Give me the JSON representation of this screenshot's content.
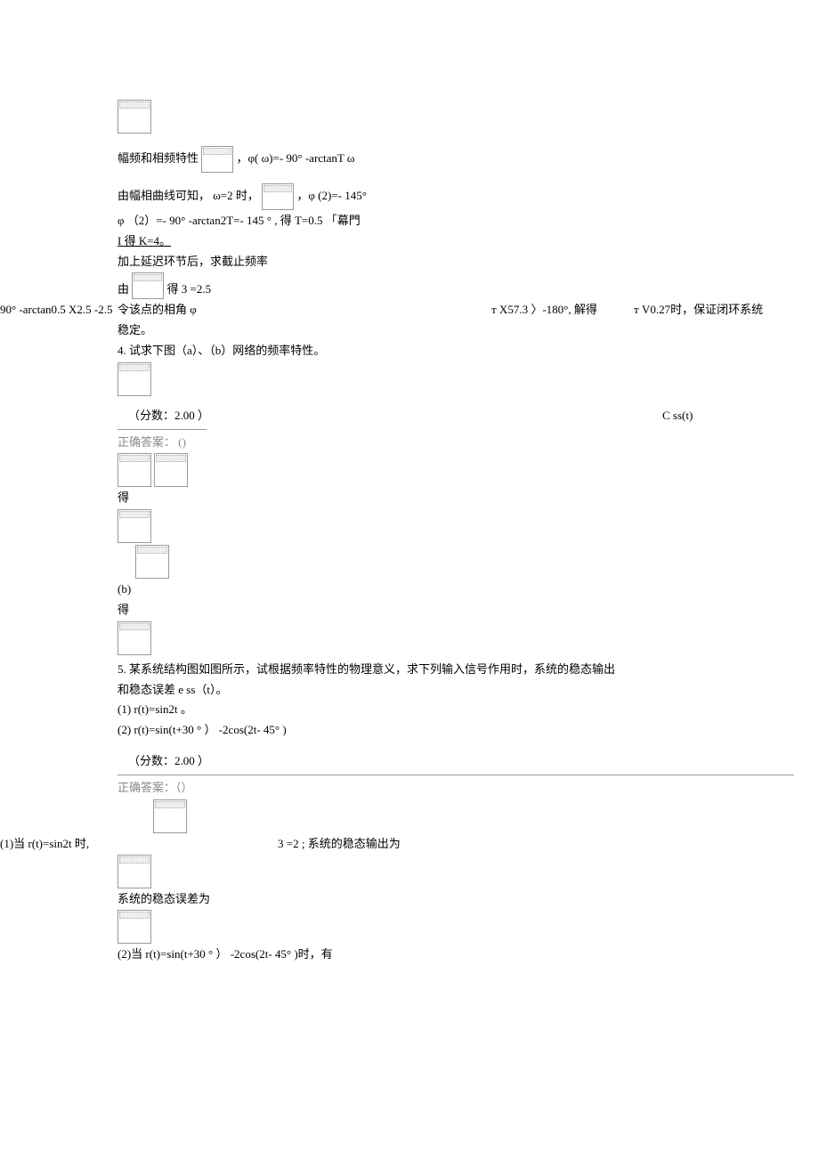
{
  "sec1": {
    "l1a": "幅频和相频特性",
    "l1b": "，φ( ω)=- 90°  -arctanT    ω",
    "l2a": "由幅相曲线可知，    ω=2 时，",
    "l2b": "，φ (2)=-  145°",
    "l3": "φ （2）=- 90°   -arctan2T=- 145 ° , 得  T=0.5 「幕門",
    "l4": "I         得 K=4。",
    "l5": "加上延迟环节后，求截止频率",
    "l6a": "由",
    "l6b": "得  3 =2.5"
  },
  "wide1": {
    "left": "90° -arctan0.5 X2.5 -2.5 ",
    "mid": "令该点的相角 φ",
    "t1": "т X57.3 〉-180°, 解得",
    "t2": "т V0.27时，保证闭环系统"
  },
  "sec2": {
    "l0": "稳定。",
    "q4": "4.      试求下图（a）、（b）网络的频率特性。",
    "score": "（分数：2.00 ）",
    "cs": "C ss(t)",
    "ans": "正确答案：  ()",
    "de1": "得",
    "b": "(b)",
    "de2": "得"
  },
  "q5": {
    "title": "5.      某系统结构图如图所示，试根据频率特性的物理意义，求下列输入信号作用时，系统的稳态输出",
    "sub": "和稳态误差 e ss（t）。",
    "i1": "(1)  r(t)=sin2t    。",
    "i2": "(2)  r(t)=sin(t+30    ° ）  -2cos(2t- 45° )",
    "score": "（分数：2.00 ）",
    "ans": "正确答案：（）"
  },
  "a5": {
    "l1left": "(1)当  r(t)=sin2t 时,",
    "l1right": "3 =2 ; 系统的稳态输出为",
    "l2": "系统的稳态误差为",
    "l3": "(2)当  r(t)=sin(t+30       ° ）  -2cos(2t- 45° )时，有"
  }
}
